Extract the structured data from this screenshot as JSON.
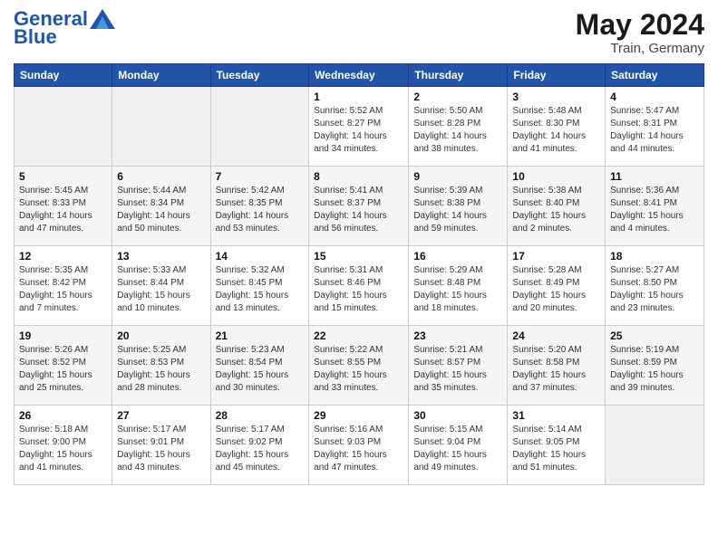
{
  "header": {
    "logo_text1": "General",
    "logo_text2": "Blue",
    "main_title": "May 2024",
    "sub_title": "Train, Germany"
  },
  "weekdays": [
    "Sunday",
    "Monday",
    "Tuesday",
    "Wednesday",
    "Thursday",
    "Friday",
    "Saturday"
  ],
  "weeks": [
    [
      {
        "day": "",
        "info": ""
      },
      {
        "day": "",
        "info": ""
      },
      {
        "day": "",
        "info": ""
      },
      {
        "day": "1",
        "info": "Sunrise: 5:52 AM\nSunset: 8:27 PM\nDaylight: 14 hours\nand 34 minutes."
      },
      {
        "day": "2",
        "info": "Sunrise: 5:50 AM\nSunset: 8:28 PM\nDaylight: 14 hours\nand 38 minutes."
      },
      {
        "day": "3",
        "info": "Sunrise: 5:48 AM\nSunset: 8:30 PM\nDaylight: 14 hours\nand 41 minutes."
      },
      {
        "day": "4",
        "info": "Sunrise: 5:47 AM\nSunset: 8:31 PM\nDaylight: 14 hours\nand 44 minutes."
      }
    ],
    [
      {
        "day": "5",
        "info": "Sunrise: 5:45 AM\nSunset: 8:33 PM\nDaylight: 14 hours\nand 47 minutes."
      },
      {
        "day": "6",
        "info": "Sunrise: 5:44 AM\nSunset: 8:34 PM\nDaylight: 14 hours\nand 50 minutes."
      },
      {
        "day": "7",
        "info": "Sunrise: 5:42 AM\nSunset: 8:35 PM\nDaylight: 14 hours\nand 53 minutes."
      },
      {
        "day": "8",
        "info": "Sunrise: 5:41 AM\nSunset: 8:37 PM\nDaylight: 14 hours\nand 56 minutes."
      },
      {
        "day": "9",
        "info": "Sunrise: 5:39 AM\nSunset: 8:38 PM\nDaylight: 14 hours\nand 59 minutes."
      },
      {
        "day": "10",
        "info": "Sunrise: 5:38 AM\nSunset: 8:40 PM\nDaylight: 15 hours\nand 2 minutes."
      },
      {
        "day": "11",
        "info": "Sunrise: 5:36 AM\nSunset: 8:41 PM\nDaylight: 15 hours\nand 4 minutes."
      }
    ],
    [
      {
        "day": "12",
        "info": "Sunrise: 5:35 AM\nSunset: 8:42 PM\nDaylight: 15 hours\nand 7 minutes."
      },
      {
        "day": "13",
        "info": "Sunrise: 5:33 AM\nSunset: 8:44 PM\nDaylight: 15 hours\nand 10 minutes."
      },
      {
        "day": "14",
        "info": "Sunrise: 5:32 AM\nSunset: 8:45 PM\nDaylight: 15 hours\nand 13 minutes."
      },
      {
        "day": "15",
        "info": "Sunrise: 5:31 AM\nSunset: 8:46 PM\nDaylight: 15 hours\nand 15 minutes."
      },
      {
        "day": "16",
        "info": "Sunrise: 5:29 AM\nSunset: 8:48 PM\nDaylight: 15 hours\nand 18 minutes."
      },
      {
        "day": "17",
        "info": "Sunrise: 5:28 AM\nSunset: 8:49 PM\nDaylight: 15 hours\nand 20 minutes."
      },
      {
        "day": "18",
        "info": "Sunrise: 5:27 AM\nSunset: 8:50 PM\nDaylight: 15 hours\nand 23 minutes."
      }
    ],
    [
      {
        "day": "19",
        "info": "Sunrise: 5:26 AM\nSunset: 8:52 PM\nDaylight: 15 hours\nand 25 minutes."
      },
      {
        "day": "20",
        "info": "Sunrise: 5:25 AM\nSunset: 8:53 PM\nDaylight: 15 hours\nand 28 minutes."
      },
      {
        "day": "21",
        "info": "Sunrise: 5:23 AM\nSunset: 8:54 PM\nDaylight: 15 hours\nand 30 minutes."
      },
      {
        "day": "22",
        "info": "Sunrise: 5:22 AM\nSunset: 8:55 PM\nDaylight: 15 hours\nand 33 minutes."
      },
      {
        "day": "23",
        "info": "Sunrise: 5:21 AM\nSunset: 8:57 PM\nDaylight: 15 hours\nand 35 minutes."
      },
      {
        "day": "24",
        "info": "Sunrise: 5:20 AM\nSunset: 8:58 PM\nDaylight: 15 hours\nand 37 minutes."
      },
      {
        "day": "25",
        "info": "Sunrise: 5:19 AM\nSunset: 8:59 PM\nDaylight: 15 hours\nand 39 minutes."
      }
    ],
    [
      {
        "day": "26",
        "info": "Sunrise: 5:18 AM\nSunset: 9:00 PM\nDaylight: 15 hours\nand 41 minutes."
      },
      {
        "day": "27",
        "info": "Sunrise: 5:17 AM\nSunset: 9:01 PM\nDaylight: 15 hours\nand 43 minutes."
      },
      {
        "day": "28",
        "info": "Sunrise: 5:17 AM\nSunset: 9:02 PM\nDaylight: 15 hours\nand 45 minutes."
      },
      {
        "day": "29",
        "info": "Sunrise: 5:16 AM\nSunset: 9:03 PM\nDaylight: 15 hours\nand 47 minutes."
      },
      {
        "day": "30",
        "info": "Sunrise: 5:15 AM\nSunset: 9:04 PM\nDaylight: 15 hours\nand 49 minutes."
      },
      {
        "day": "31",
        "info": "Sunrise: 5:14 AM\nSunset: 9:05 PM\nDaylight: 15 hours\nand 51 minutes."
      },
      {
        "day": "",
        "info": ""
      }
    ]
  ]
}
